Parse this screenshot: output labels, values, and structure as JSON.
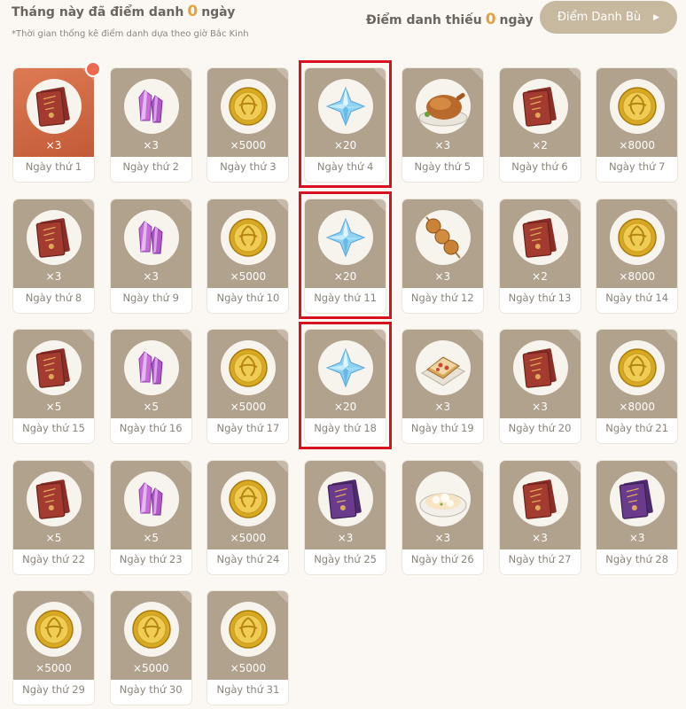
{
  "header": {
    "checked_prefix": "Tháng này đã điểm danh",
    "checked_count": "0",
    "checked_suffix": "ngày",
    "note": "*Thời gian thống kê điểm danh dựa theo giờ Bắc Kinh",
    "missed_prefix": "Điểm danh thiếu",
    "missed_count": "0",
    "missed_suffix": "ngày",
    "makeup_button": "Điểm Danh Bù"
  },
  "colors": {
    "accent_count": "#e0a341",
    "card_bg": "#b0a28d",
    "today_card": "#c35a37",
    "highlight_border": "#d7111e",
    "button_bg": "#c7b9a0"
  },
  "rewards": [
    {
      "day": "Ngày thứ 1",
      "qty": "×3",
      "icon": "hero-wit-book-icon",
      "today": true
    },
    {
      "day": "Ngày thứ 2",
      "qty": "×3",
      "icon": "enhancement-ore-icon"
    },
    {
      "day": "Ngày thứ 3",
      "qty": "×5000",
      "icon": "mora-coin-icon"
    },
    {
      "day": "Ngày thứ 4",
      "qty": "×20",
      "icon": "primogem-icon",
      "highlighted": true
    },
    {
      "day": "Ngày thứ 5",
      "qty": "×3",
      "icon": "roast-chicken-icon"
    },
    {
      "day": "Ngày thứ 6",
      "qty": "×2",
      "icon": "hero-wit-book-icon"
    },
    {
      "day": "Ngày thứ 7",
      "qty": "×8000",
      "icon": "mora-coin-icon"
    },
    {
      "day": "Ngày thứ 8",
      "qty": "×3",
      "icon": "hero-wit-book-icon"
    },
    {
      "day": "Ngày thứ 9",
      "qty": "×3",
      "icon": "enhancement-ore-icon"
    },
    {
      "day": "Ngày thứ 10",
      "qty": "×5000",
      "icon": "mora-coin-icon"
    },
    {
      "day": "Ngày thứ 11",
      "qty": "×20",
      "icon": "primogem-icon",
      "highlighted": true
    },
    {
      "day": "Ngày thứ 12",
      "qty": "×3",
      "icon": "meat-skewer-icon"
    },
    {
      "day": "Ngày thứ 13",
      "qty": "×2",
      "icon": "hero-wit-book-icon"
    },
    {
      "day": "Ngày thứ 14",
      "qty": "×8000",
      "icon": "mora-coin-icon"
    },
    {
      "day": "Ngày thứ 15",
      "qty": "×5",
      "icon": "hero-wit-book-icon"
    },
    {
      "day": "Ngày thứ 16",
      "qty": "×5",
      "icon": "enhancement-ore-icon"
    },
    {
      "day": "Ngày thứ 17",
      "qty": "×5000",
      "icon": "mora-coin-icon"
    },
    {
      "day": "Ngày thứ 18",
      "qty": "×20",
      "icon": "primogem-icon",
      "highlighted": true
    },
    {
      "day": "Ngày thứ 19",
      "qty": "×3",
      "icon": "toast-dish-icon"
    },
    {
      "day": "Ngày thứ 20",
      "qty": "×3",
      "icon": "hero-wit-book-icon"
    },
    {
      "day": "Ngày thứ 21",
      "qty": "×8000",
      "icon": "mora-coin-icon"
    },
    {
      "day": "Ngày thứ 22",
      "qty": "×5",
      "icon": "hero-wit-book-icon"
    },
    {
      "day": "Ngày thứ 23",
      "qty": "×5",
      "icon": "enhancement-ore-icon"
    },
    {
      "day": "Ngày thứ 24",
      "qty": "×5000",
      "icon": "mora-coin-icon"
    },
    {
      "day": "Ngày thứ 25",
      "qty": "×3",
      "icon": "purple-book-icon"
    },
    {
      "day": "Ngày thứ 26",
      "qty": "×3",
      "icon": "stew-dish-icon"
    },
    {
      "day": "Ngày thứ 27",
      "qty": "×3",
      "icon": "hero-wit-book-icon"
    },
    {
      "day": "Ngày thứ 28",
      "qty": "×3",
      "icon": "purple-book-icon"
    },
    {
      "day": "Ngày thứ 29",
      "qty": "×5000",
      "icon": "mora-coin-icon"
    },
    {
      "day": "Ngày thứ 30",
      "qty": "×5000",
      "icon": "mora-coin-icon"
    },
    {
      "day": "Ngày thứ 31",
      "qty": "×5000",
      "icon": "mora-coin-icon"
    }
  ]
}
